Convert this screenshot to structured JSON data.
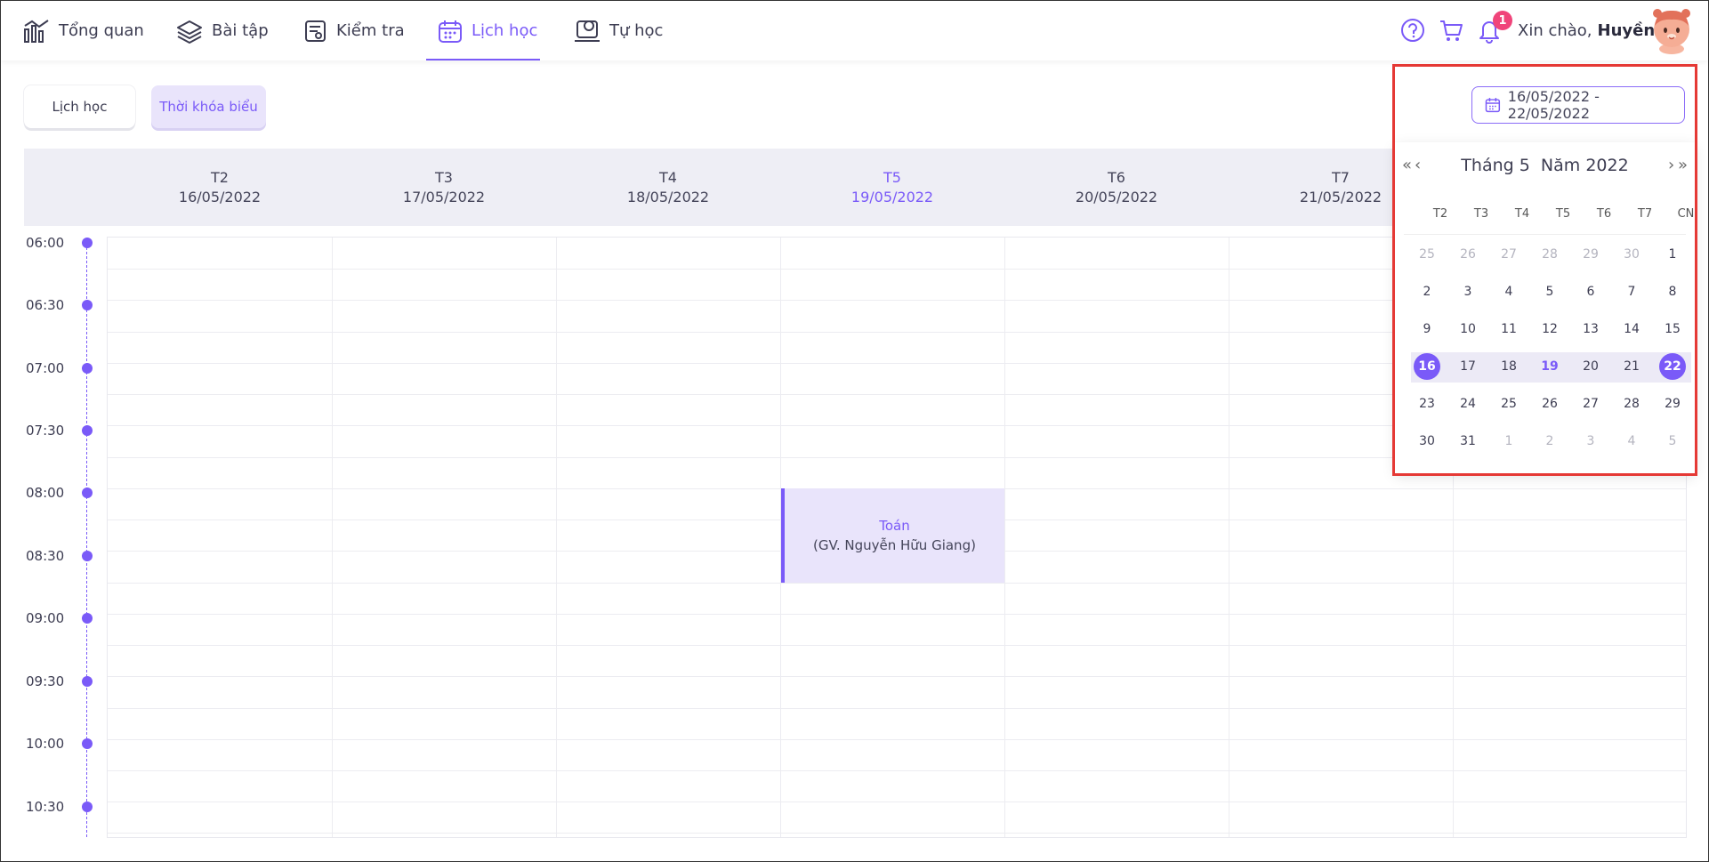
{
  "nav": {
    "items": [
      {
        "label": "Tổng quan",
        "icon": "chart-bar-icon"
      },
      {
        "label": "Bài tập",
        "icon": "layers-icon"
      },
      {
        "label": "Kiểm tra",
        "icon": "test-sheet-icon"
      },
      {
        "label": "Lịch học",
        "icon": "calendar-icon",
        "active": true
      },
      {
        "label": "Tự học",
        "icon": "self-study-icon"
      }
    ],
    "notification_count": "1",
    "greeting": "Xin chào,",
    "user_name": "Huyền"
  },
  "tabs": {
    "list_label": "Lịch học",
    "timetable_label": "Thời khóa biểu"
  },
  "week": {
    "days": [
      {
        "label": "T2",
        "date": "16/05/2022"
      },
      {
        "label": "T3",
        "date": "17/05/2022"
      },
      {
        "label": "T4",
        "date": "18/05/2022"
      },
      {
        "label": "T5",
        "date": "19/05/2022",
        "today": true
      },
      {
        "label": "T6",
        "date": "20/05/2022"
      },
      {
        "label": "T7",
        "date": "21/05/2022"
      }
    ]
  },
  "times": [
    "06:00",
    "06:30",
    "07:00",
    "07:30",
    "08:00",
    "08:30",
    "09:00",
    "09:30",
    "10:00",
    "10:30"
  ],
  "event": {
    "subject": "Toán",
    "teacher": "(GV. Nguyễn Hữu Giang)",
    "day": "T5",
    "start": "08:00",
    "end": "08:45"
  },
  "date_range": "16/05/2022 - 22/05/2022",
  "calendar": {
    "title_month": "Tháng 5",
    "title_year": "Năm 2022",
    "weekdays": [
      "T2",
      "T3",
      "T4",
      "T5",
      "T6",
      "T7",
      "CN"
    ],
    "weeks": [
      [
        "25",
        "26",
        "27",
        "28",
        "29",
        "30",
        "1"
      ],
      [
        "2",
        "3",
        "4",
        "5",
        "6",
        "7",
        "8"
      ],
      [
        "9",
        "10",
        "11",
        "12",
        "13",
        "14",
        "15"
      ],
      [
        "16",
        "17",
        "18",
        "19",
        "20",
        "21",
        "22"
      ],
      [
        "23",
        "24",
        "25",
        "26",
        "27",
        "28",
        "29"
      ],
      [
        "30",
        "31",
        "1",
        "2",
        "3",
        "4",
        "5"
      ]
    ],
    "selected_start": "16",
    "selected_end": "22",
    "today": "19"
  },
  "colors": {
    "accent": "#7a5af8",
    "accent_light": "#e9e4fb",
    "badge": "#f0447a",
    "highlight": "#e53935"
  }
}
